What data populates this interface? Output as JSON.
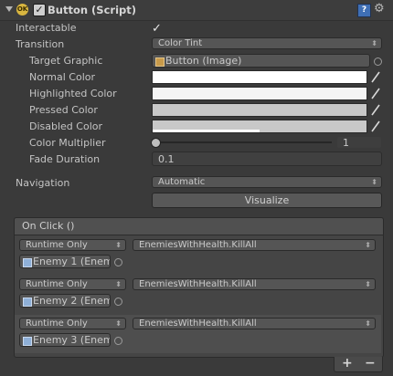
{
  "component": {
    "title": "Button (Script)",
    "icon_text": "OK",
    "enabled": true
  },
  "fields": {
    "interactable": {
      "label": "Interactable",
      "checked": true
    },
    "transition": {
      "label": "Transition",
      "value": "Color Tint"
    },
    "target_graphic": {
      "label": "Target Graphic",
      "value": "Button (Image)"
    },
    "normal_color": {
      "label": "Normal Color",
      "color": "#ffffff"
    },
    "highlighted_color": {
      "label": "Highlighted Color",
      "color": "#f5f5f5"
    },
    "pressed_color": {
      "label": "Pressed Color",
      "color": "#c8c8c8"
    },
    "disabled_color": {
      "label": "Disabled Color",
      "color": "#c8c8c8",
      "alpha": 0.5
    },
    "color_multiplier": {
      "label": "Color Multiplier",
      "value": "1"
    },
    "fade_duration": {
      "label": "Fade Duration",
      "value": "0.1"
    },
    "navigation": {
      "label": "Navigation",
      "value": "Automatic"
    },
    "visualize": {
      "label": "Visualize"
    }
  },
  "on_click": {
    "header": "On Click ()",
    "events": [
      {
        "mode": "Runtime Only",
        "function": "EnemiesWithHealth.KillAll",
        "object": "Enemy 1 (Enem"
      },
      {
        "mode": "Runtime Only",
        "function": "EnemiesWithHealth.KillAll",
        "object": "Enemy 2 (Enem"
      },
      {
        "mode": "Runtime Only",
        "function": "EnemiesWithHealth.KillAll",
        "object": "Enemy 3 (Enem"
      }
    ],
    "add_label": "+",
    "remove_label": "−"
  }
}
